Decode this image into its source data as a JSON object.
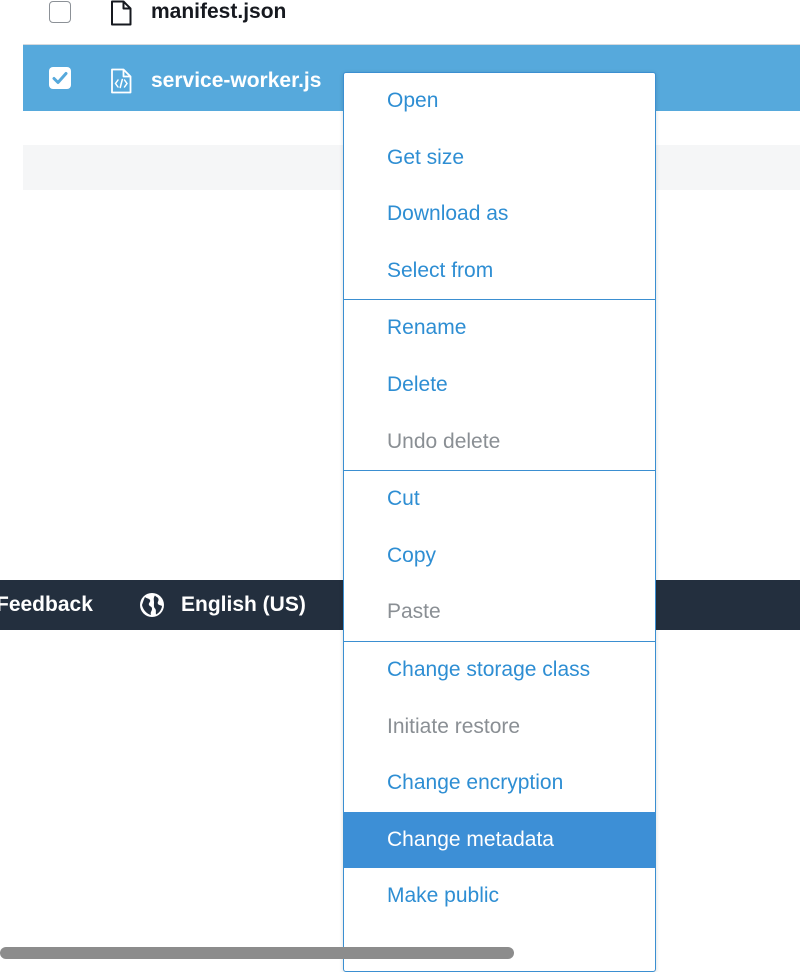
{
  "files": [
    {
      "name": "manifest.json",
      "selected": false,
      "icon": "file-icon"
    },
    {
      "name": "service-worker.js",
      "selected": true,
      "icon": "code-file-icon"
    }
  ],
  "footer": {
    "feedback": "Feedback",
    "language": "English (US)",
    "globe_icon": "globe-icon"
  },
  "context_menu": {
    "groups": [
      {
        "items": [
          {
            "label": "Open",
            "state": "enabled"
          },
          {
            "label": "Get size",
            "state": "enabled"
          },
          {
            "label": "Download as",
            "state": "enabled"
          },
          {
            "label": "Select from",
            "state": "enabled"
          }
        ]
      },
      {
        "items": [
          {
            "label": "Rename",
            "state": "enabled"
          },
          {
            "label": "Delete",
            "state": "enabled"
          },
          {
            "label": "Undo delete",
            "state": "disabled"
          }
        ]
      },
      {
        "items": [
          {
            "label": "Cut",
            "state": "enabled"
          },
          {
            "label": "Copy",
            "state": "enabled"
          },
          {
            "label": "Paste",
            "state": "disabled"
          }
        ]
      },
      {
        "items": [
          {
            "label": "Change storage class",
            "state": "enabled"
          },
          {
            "label": "Initiate restore",
            "state": "disabled"
          },
          {
            "label": "Change encryption",
            "state": "enabled"
          },
          {
            "label": "Change metadata",
            "state": "active"
          },
          {
            "label": "Make public",
            "state": "enabled"
          }
        ]
      }
    ]
  },
  "colors": {
    "selected_row": "#56a9dc",
    "menu_border": "#3b8fd1",
    "menu_text": "#2e8ed3",
    "menu_disabled": "#8a8f94",
    "menu_active_bg": "#3d8fd6",
    "footer_bg": "#232f3e"
  }
}
